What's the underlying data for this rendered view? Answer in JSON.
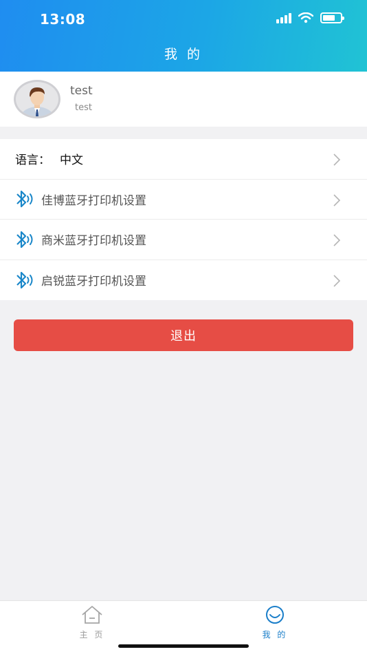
{
  "status_bar": {
    "time": "13:08"
  },
  "header": {
    "title": "我 的"
  },
  "profile": {
    "name": "test",
    "subtitle": "test"
  },
  "menu": {
    "language_label": "语言：",
    "language_value": "中文",
    "items": [
      {
        "label": "佳博蓝牙打印机设置",
        "icon": "bluetooth-icon"
      },
      {
        "label": "商米蓝牙打印机设置",
        "icon": "bluetooth-icon"
      },
      {
        "label": "启锐蓝牙打印机设置",
        "icon": "bluetooth-icon"
      }
    ]
  },
  "logout": {
    "label": "退出"
  },
  "tabbar": {
    "tabs": [
      {
        "label": "主 页",
        "icon": "home-icon",
        "active": false
      },
      {
        "label": "我 的",
        "icon": "smile-icon",
        "active": true
      }
    ]
  },
  "colors": {
    "header_start": "#1f8df0",
    "header_end": "#20c3d4",
    "logout": "#e64d45",
    "active_tab": "#1a7ec9",
    "bluetooth": "#1a87c9"
  }
}
